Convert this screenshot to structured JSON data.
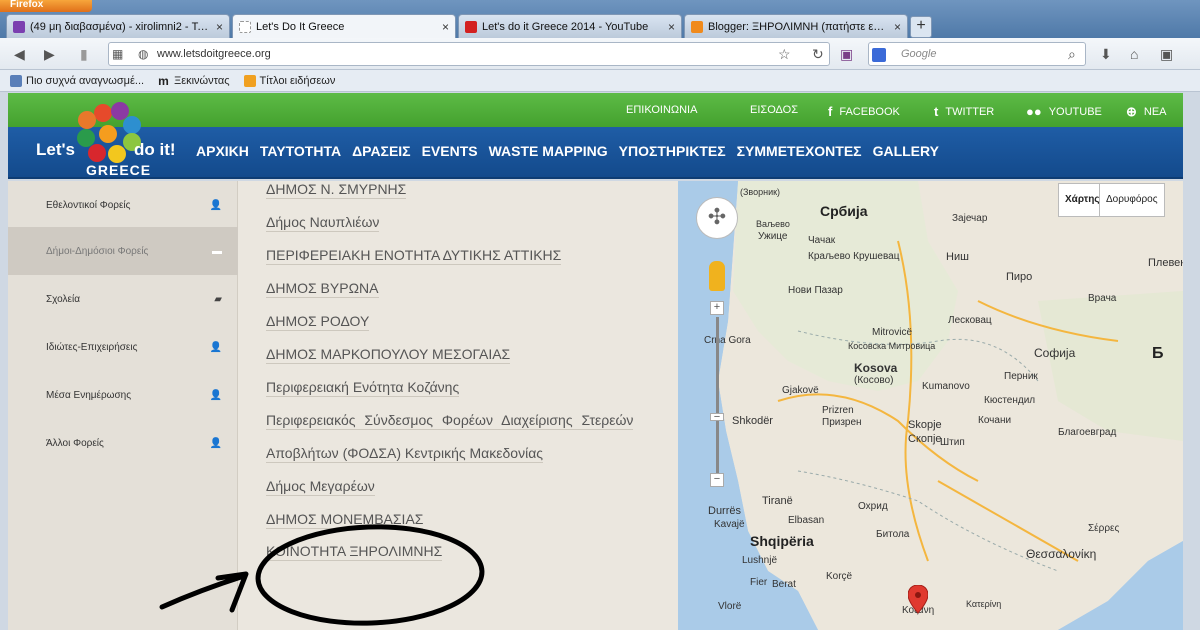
{
  "browser": {
    "firefox_button": "Firefox",
    "tabs": [
      {
        "label": "(49 μη διαβασμένα) - xirolimni2 - Ταχ...",
        "active": false,
        "favicon_color": "#7b3fb0"
      },
      {
        "label": "Let's Do It Greece",
        "active": true,
        "favicon_color": "#ffffff"
      },
      {
        "label": "Let's do it Greece 2014 - YouTube",
        "active": false,
        "favicon_color": "#d32020"
      },
      {
        "label": "Blogger: ΞΗΡΟΛΙΜΝΗ (πατήστε εδώ...",
        "active": false,
        "favicon_color": "#f08a1c"
      }
    ],
    "url": "www.letsdoitgreece.org",
    "search_placeholder": "Google",
    "bookmarks": [
      {
        "label": "Πιο συχνά αναγνωσμέ...",
        "icon": "bookmark-icon"
      },
      {
        "label": "Ξεκινώντας",
        "icon": "m-logo-icon"
      },
      {
        "label": "Τίτλοι ειδήσεων",
        "icon": "rss-icon"
      }
    ]
  },
  "site": {
    "logo": {
      "lets": "Let's",
      "doit": "do it!",
      "greece": "GREECE"
    },
    "top_links": {
      "contact": "ΕΠΙΚΟΙΝΩΝΙΑ",
      "login": "ΕΙΣΟΔΟΣ",
      "facebook": "FACEBOOK",
      "twitter": "TWITTER",
      "youtube": "YOUTUBE",
      "news": "ΝΕΑ"
    },
    "menu": [
      "ΑΡΧΙΚΗ",
      "ΤΑΥΤΟΤΗΤΑ",
      "ΔΡΑΣΕΙΣ",
      "EVENTS",
      "WASTE MAPPING",
      "ΥΠΟΣΤΗΡΙΚΤΕΣ",
      "ΣΥΜΜΕΤΕΧΟΝΤΕΣ",
      "GALLERY"
    ]
  },
  "sidebar": {
    "items": [
      {
        "label": "Εθελοντικοί Φορείς",
        "active": false,
        "icon": "user-icon"
      },
      {
        "label": "Δήμοι-Δημόσιοι Φορείς",
        "active": true,
        "icon": "folder-icon"
      },
      {
        "label": "Σχολεία",
        "active": false,
        "icon": "book-icon"
      },
      {
        "label": "Ιδιώτες-Επιχειρήσεις",
        "active": false,
        "icon": "user-icon"
      },
      {
        "label": "Μέσα Ενημέρωσης",
        "active": false,
        "icon": "user-icon"
      },
      {
        "label": "Άλλοι Φορείς",
        "active": false,
        "icon": "user-icon"
      }
    ]
  },
  "list": {
    "items": [
      "ΔΗΜΟΣ Ν. ΣΜΥΡΝΗΣ",
      "Δήμος Ναυπλιέων",
      "ΠΕΡΙΦΕΡΕΙΑΚΗ ΕΝΟΤΗΤΑ ΔΥΤΙΚΗΣ ΑΤΤΙΚΗΣ",
      "ΔΗΜΟΣ ΒΥΡΩΝΑ",
      "ΔΗΜΟΣ ΡΟΔΟΥ",
      "ΔΗΜΟΣ ΜΑΡΚΟΠΟΥΛΟΥ ΜΕΣΟΓΑΙΑΣ",
      "Περιφερειακή Ενότητα Κοζάνης",
      "Περιφερειακός Σύνδεσμος Φορέων Διαχείρισης Στερεών",
      "Αποβλήτων (ΦΟΔΣΑ) Κεντρικής Μακεδονίας",
      "Δήμος Μεγαρέων",
      "ΔΗΜΟΣ ΜΟΝΕΜΒΑΣΙΑΣ",
      "ΚΟΙΝΟΤΗΤΑ ΞΗΡΟΛΙΜΝΗΣ"
    ]
  },
  "map": {
    "controls": {
      "map": "Χάρτης",
      "satellite": "Δορυφόρος"
    },
    "labels": [
      {
        "text": "Србија",
        "big": true
      },
      {
        "text": "(Зворник)",
        "big": false
      },
      {
        "text": "Ваљево",
        "big": false
      },
      {
        "text": "Зајечар",
        "big": false
      },
      {
        "text": "Ужице",
        "big": false
      },
      {
        "text": "Чачак",
        "big": false
      },
      {
        "text": "Ниш",
        "big": false
      },
      {
        "text": "Пиро",
        "big": false
      },
      {
        "text": "Плевен",
        "big": false
      },
      {
        "text": "Краљево Крушевац",
        "big": false
      },
      {
        "text": "Нови Пазар",
        "big": false
      },
      {
        "text": "Лесковац",
        "big": false
      },
      {
        "text": "Врачa",
        "big": false
      },
      {
        "text": "Crna Gora",
        "big": false
      },
      {
        "text": "Mitrovicë",
        "big": false
      },
      {
        "text": "Косовска Митровица",
        "big": false
      },
      {
        "text": "Софија",
        "big": false
      },
      {
        "text": "Kosova",
        "big": false
      },
      {
        "text": "(Косово)",
        "big": false
      },
      {
        "text": "Перник",
        "big": false
      },
      {
        "text": "Gjakovë",
        "big": false
      },
      {
        "text": "Prizren",
        "big": false
      },
      {
        "text": "Призрен",
        "big": false
      },
      {
        "text": "Kumanovo",
        "big": false
      },
      {
        "text": "Кюстендил",
        "big": false
      },
      {
        "text": "Shkodër",
        "big": false
      },
      {
        "text": "Skopje",
        "big": false
      },
      {
        "text": "Скопје",
        "big": false
      },
      {
        "text": "Благоевград",
        "big": false
      },
      {
        "text": "Кочани",
        "big": false
      },
      {
        "text": "Штип",
        "big": false
      },
      {
        "text": "Tiranë",
        "big": false
      },
      {
        "text": "Охрид",
        "big": false
      },
      {
        "text": "Durrës",
        "big": false
      },
      {
        "text": "Kavajë",
        "big": false
      },
      {
        "text": "Elbasan",
        "big": false
      },
      {
        "text": "Shqipëria",
        "big": true
      },
      {
        "text": "Битола",
        "big": false
      },
      {
        "text": "Σέρρες",
        "big": false
      },
      {
        "text": "Lushnjë",
        "big": false
      },
      {
        "text": "Fier",
        "big": false
      },
      {
        "text": "Berat",
        "big": false
      },
      {
        "text": "Korçë",
        "big": false
      },
      {
        "text": "Θεσσαλονίκη",
        "big": false
      },
      {
        "text": "Vlorë",
        "big": false
      },
      {
        "text": "Κοζάνη",
        "big": false
      },
      {
        "text": "Κατερίνη",
        "big": false
      },
      {
        "text": "Б",
        "big": false
      }
    ]
  },
  "annotation_color": "#000000"
}
